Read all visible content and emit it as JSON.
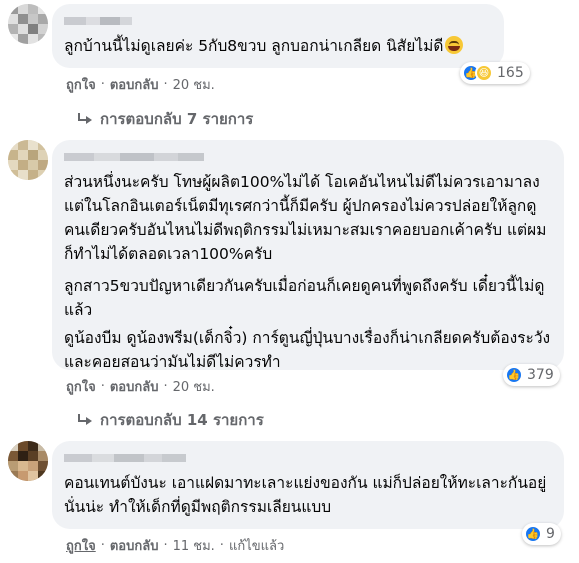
{
  "comments": [
    {
      "text": [
        "ลูกบ้านนี้ไม่ดูเลยค่ะ 5กับ8ขวบ ลูกบอกน่าเกลียด นิสัยไม่ดี"
      ],
      "emoji": "grinning-squinting-face",
      "reactions": {
        "count": "165",
        "types": [
          "like-icon",
          "haha-icon"
        ]
      },
      "actions": {
        "like": "ถูกใจ",
        "reply": "ตอบกลับ",
        "time": "20 ชม."
      },
      "replies_label": "การตอบกลับ 7 รายการ"
    },
    {
      "text": [
        "ส่วนหนึ่งนะครับ โทษผู้ผลิต100%ไม่ได้ โอเคอันไหนไม่ดีไม่ควรเอามาลง แต่ในโลกอินเตอร์เน็ตมีทุเรศกว่านี้ก็มีครับ ผู้ปกครองไม่ควรปล่อยให้ลูกดูคนเดียวครับอันไหนไม่ดีพฤติกรรมไม่เหมาะสมเราคอยบอกเค้าครับ แต่ผมก็ทำไม่ได้ตลอดเวลา100%ครับ",
        "ลูกสาว5ขวบปัญหาเดียวกันครับเมื่อก่อนก็เคยดูคนที่พูดถึงครับ เดี๋ยวนี้ไม่ดูแล้ว",
        "ดูน้องบีม ดูน้องพรีม(เด็กจิ๋ว) การ์ตูนญี่ปุ่นบางเรื่องก็น่าเกลียดครับต้องระวังและคอยสอนว่ามันไม่ดีไม่ควรทำ"
      ],
      "reactions": {
        "count": "379",
        "types": [
          "like-icon"
        ]
      },
      "actions": {
        "like": "ถูกใจ",
        "reply": "ตอบกลับ",
        "time": "20 ชม."
      },
      "replies_label": "การตอบกลับ 14 รายการ"
    },
    {
      "text": [
        "คอนเทนต์บังนะ เอาแฝดมาทะเลาะแย่งของกัน แม่ก็ปล่อยให้ทะเลาะกันอยู่นั่นน่ะ ทำให้เด็กที่ดูมีพฤติกรรมเลียนแบบ"
      ],
      "reactions": {
        "count": "9",
        "types": [
          "like-icon"
        ]
      },
      "actions": {
        "like": "ถูกใจ",
        "reply": "ตอบกลับ",
        "time": "11 ชม.",
        "edited": "แก้ไขแล้ว"
      }
    }
  ],
  "colors": {
    "bubble": "#f0f2f5",
    "secondary_text": "#65676b",
    "like_blue": "#1877f2",
    "haha_yellow": "#f7c836"
  }
}
